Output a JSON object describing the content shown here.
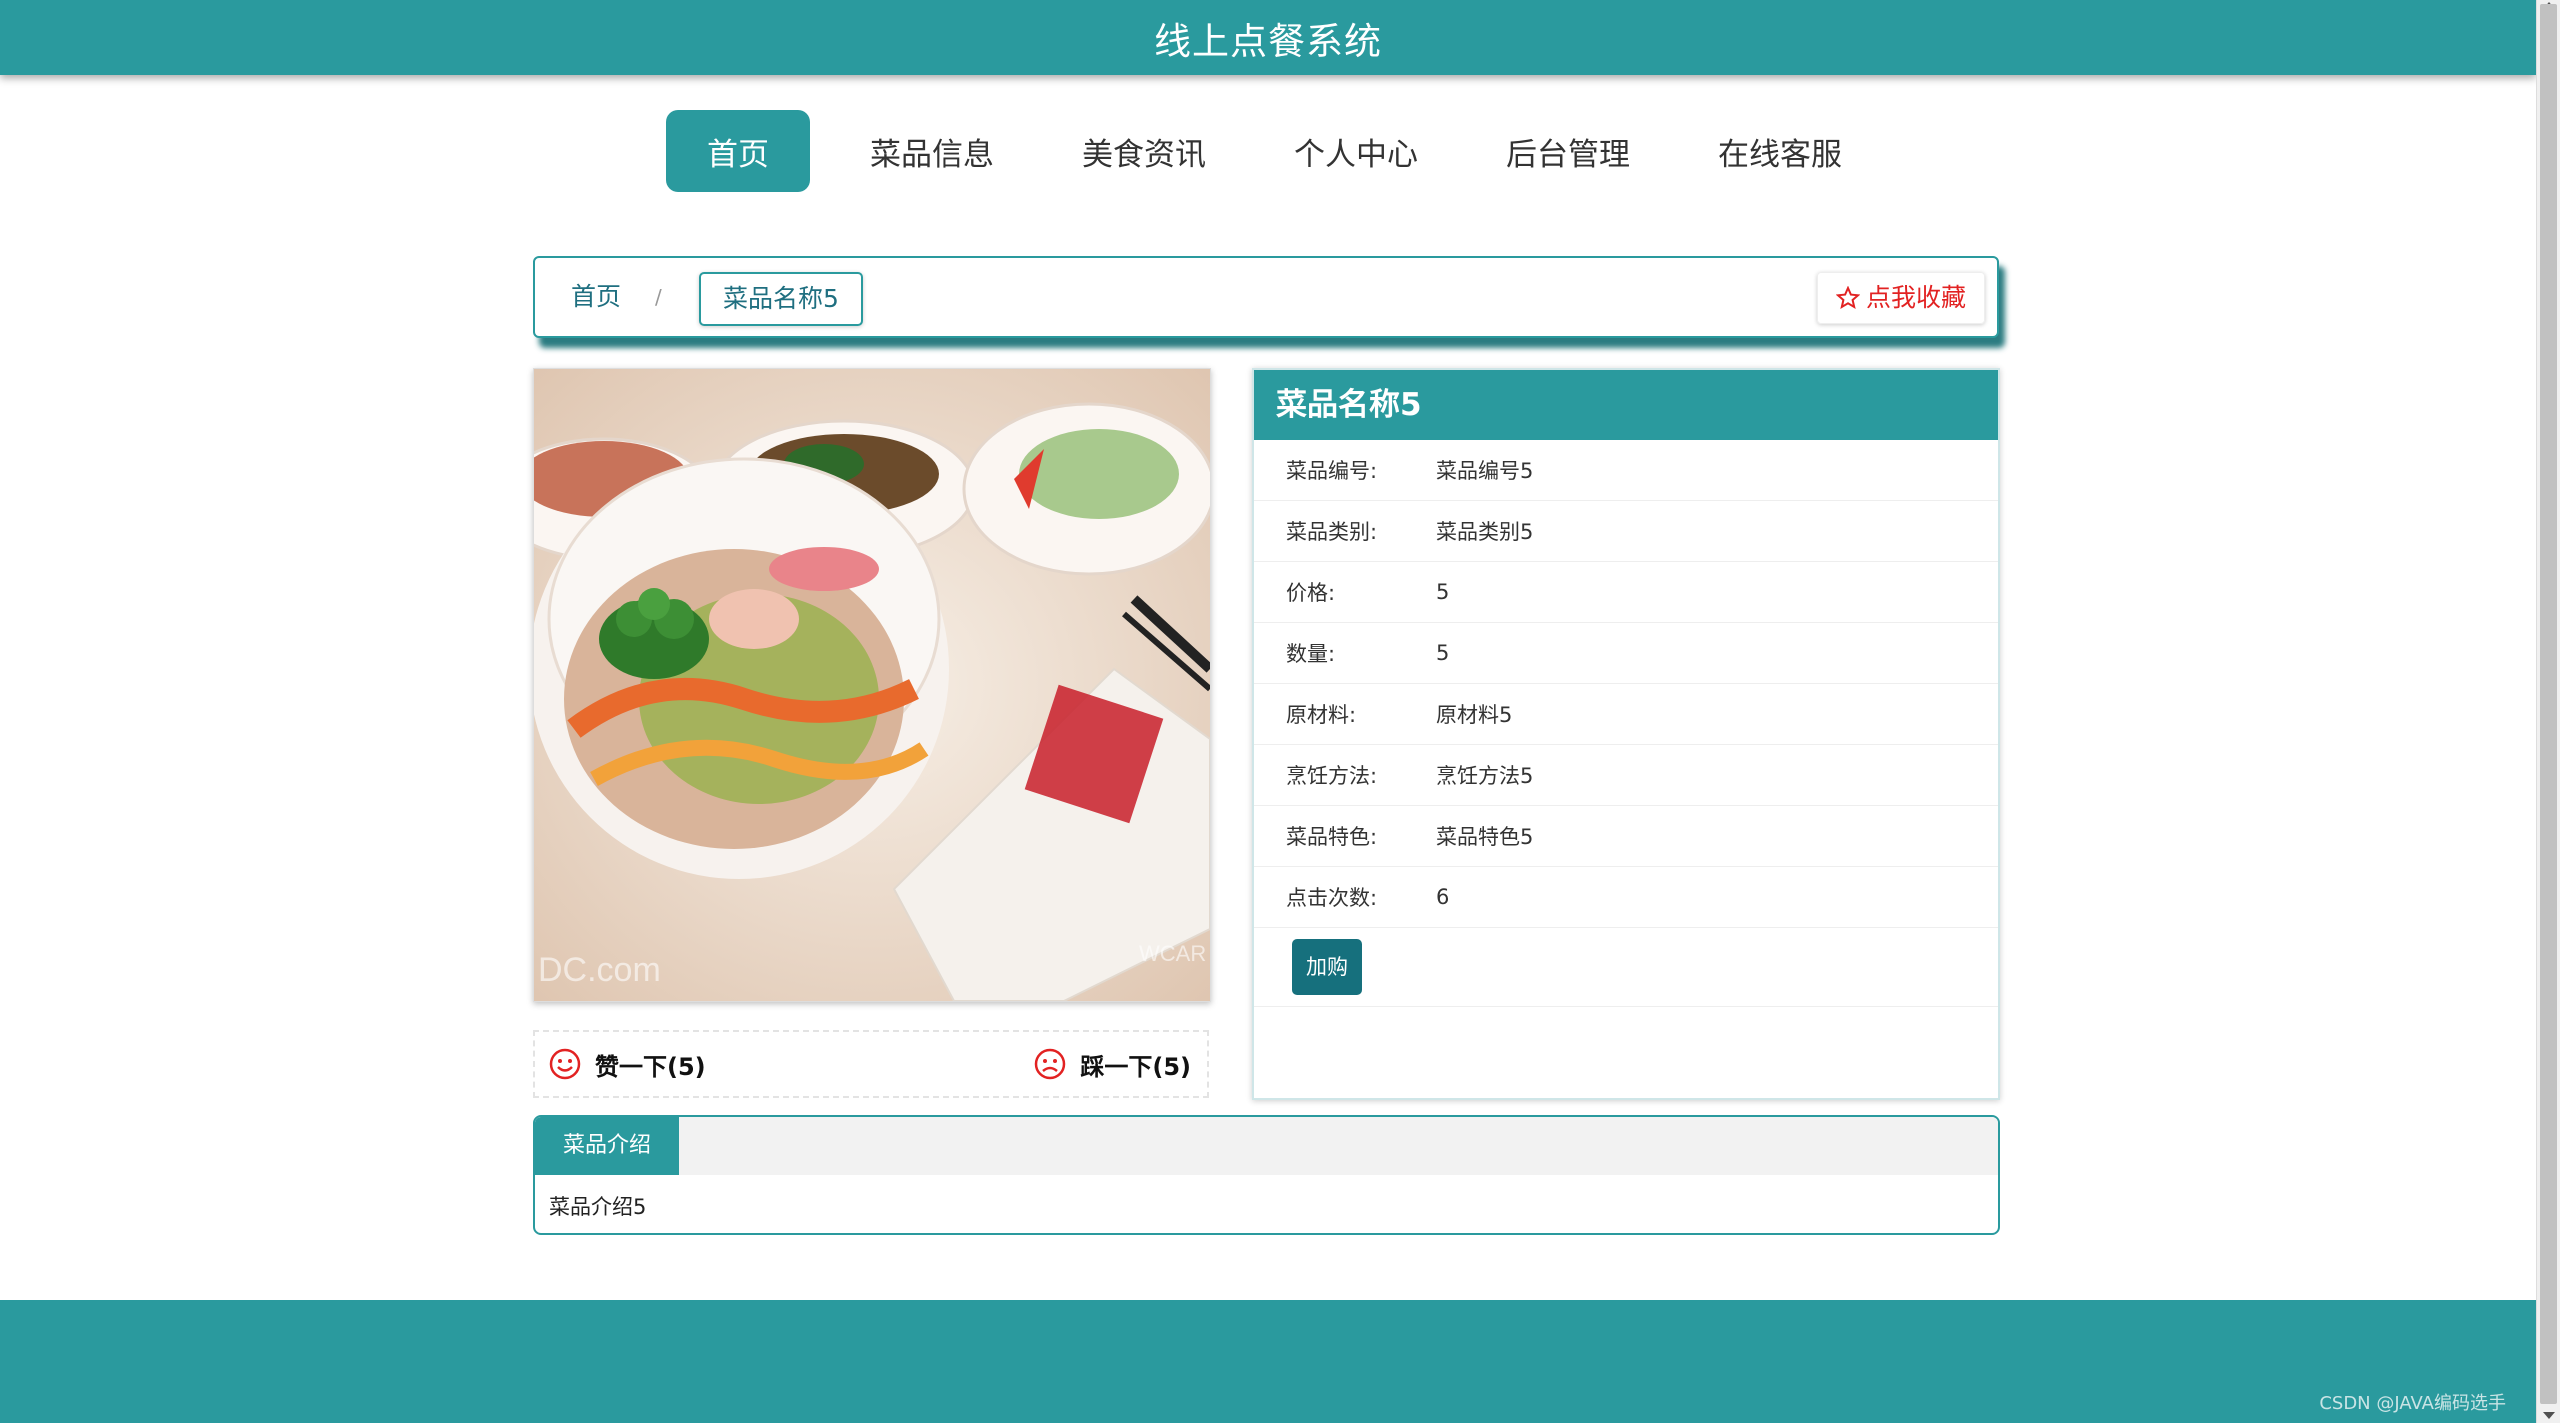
{
  "header": {
    "title": "线上点餐系统"
  },
  "nav": {
    "items": [
      {
        "label": "首页",
        "active": true
      },
      {
        "label": "菜品信息"
      },
      {
        "label": "美食资讯"
      },
      {
        "label": "个人中心"
      },
      {
        "label": "后台管理"
      },
      {
        "label": "在线客服"
      }
    ]
  },
  "breadcrumb": {
    "home": "首页",
    "separator": "/",
    "current": "菜品名称5"
  },
  "favorite": {
    "label": "点我收藏",
    "icon": "star-outline-icon"
  },
  "votes": {
    "like_label": "赞一下(5)",
    "like_icon": "smile-icon",
    "dislike_label": "踩一下(5)",
    "dislike_icon": "frown-icon"
  },
  "details": {
    "title": "菜品名称5",
    "rows": [
      {
        "key": "菜品编号:",
        "value": "菜品编号5"
      },
      {
        "key": "菜品类别:",
        "value": "菜品类别5"
      },
      {
        "key": "价格:",
        "value": "5"
      },
      {
        "key": "数量:",
        "value": "5"
      },
      {
        "key": "原材料:",
        "value": "原材料5"
      },
      {
        "key": "烹饪方法:",
        "value": "烹饪方法5"
      },
      {
        "key": "菜品特色:",
        "value": "菜品特色5"
      },
      {
        "key": "点击次数:",
        "value": "6"
      }
    ],
    "add_button": "加购"
  },
  "intro": {
    "tab": "菜品介绍",
    "content": "菜品介绍5"
  },
  "image_watermark": {
    "left": "DC.com",
    "right": "WCAR"
  },
  "watermark": "CSDN @JAVA编码选手",
  "colors": {
    "primary": "#2a9a9e",
    "button": "#16707d",
    "favorite": "#e22222"
  }
}
